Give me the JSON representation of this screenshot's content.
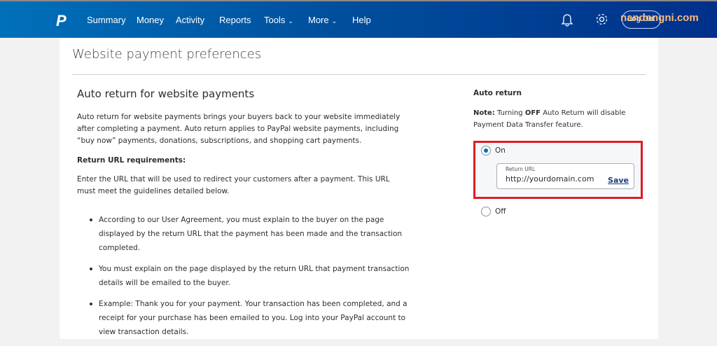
{
  "header": {
    "logo": "P",
    "nav": [
      {
        "label": "Summary"
      },
      {
        "label": "Money"
      },
      {
        "label": "Activity"
      },
      {
        "label": "Reports"
      },
      {
        "label": "Tools",
        "dropdown": true
      },
      {
        "label": "More",
        "dropdown": true
      },
      {
        "label": "Help"
      }
    ],
    "chevron": "⌄",
    "logout_label": "Log Out",
    "watermark": "nandongni.com",
    "icons": [
      "bell-icon",
      "gear-icon"
    ]
  },
  "page": {
    "title": "Website payment preferences"
  },
  "left": {
    "heading": "Auto return for website payments",
    "intro": "Auto return for website payments brings your buyers back to your website immediately after completing a payment. Auto return applies to PayPal website payments, including “buy now” payments, donations, subscriptions, and shopping cart payments.",
    "req_heading": "Return URL requirements:",
    "req_text": "Enter the URL that will be used to redirect your customers after a payment. This URL must meet the guidelines detailed below.",
    "bullets": [
      "According to our User Agreement, you must explain to the buyer on the page displayed by the return URL that the payment has been made and the transaction completed.",
      "You must explain on the page displayed by the return URL that payment transaction details will be emailed to the buyer.",
      "Example: Thank you for your payment. Your transaction has been completed, and a receipt for your purchase has been emailed to you. Log into your PayPal account to view transaction details."
    ]
  },
  "right": {
    "heading": "Auto return",
    "note_label": "Note:",
    "note_pre": " Turning ",
    "note_bold": "OFF",
    "note_post": " Auto Return will disable Payment Data Transfer feature.",
    "options": [
      {
        "label": "On",
        "selected": true
      },
      {
        "label": "Off",
        "selected": false
      }
    ],
    "return_url_label": "Return URL",
    "return_url_value": "http://yourdomain.com",
    "save_label": "Save",
    "highlight_color": "#e01b24"
  }
}
